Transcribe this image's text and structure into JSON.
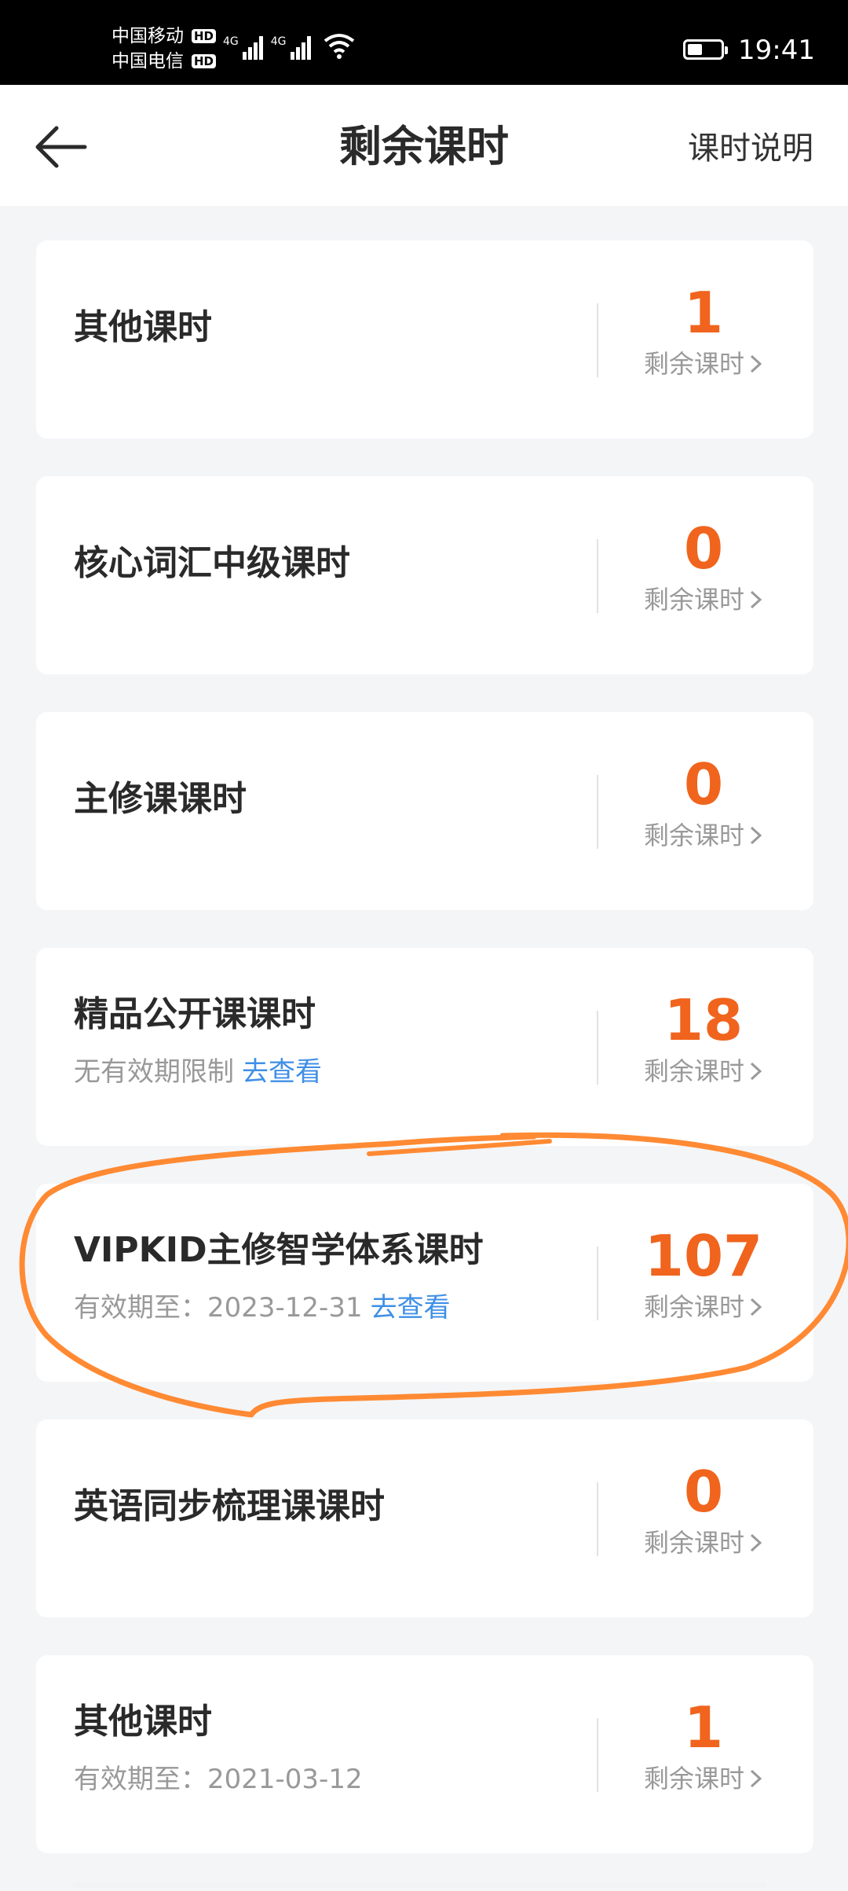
{
  "status_bar": {
    "carrier_1": "中国移动",
    "carrier_2": "中国电信",
    "hd_label": "HD",
    "network_1": "4G",
    "network_2": "4G",
    "time": "19:41",
    "battery_level": 0.45
  },
  "header": {
    "title": "剩余课时",
    "right_link": "课时说明"
  },
  "cards": [
    {
      "name": "其他课时",
      "count": "1",
      "caption": "剩余课时"
    },
    {
      "name": "核心词汇中级课时",
      "count": "0",
      "caption": "剩余课时"
    },
    {
      "name": "主修课课时",
      "count": "0",
      "caption": "剩余课时"
    },
    {
      "name": "精品公开课课时",
      "sub": "无有效期限制",
      "link": "去查看",
      "count": "18",
      "caption": "剩余课时"
    },
    {
      "name": "VIPKID主修智学体系课时",
      "sub": "有效期至：2023-12-31",
      "link": "去查看",
      "count": "107",
      "caption": "剩余课时"
    },
    {
      "name": "英语同步梳理课课时",
      "count": "0",
      "caption": "剩余课时"
    },
    {
      "name": "其他课时",
      "sub": "有效期至：2021-03-12",
      "count": "1",
      "caption": "剩余课时"
    }
  ],
  "colors": {
    "accent": "#f0641e",
    "link": "#3f8fe6",
    "annotation": "#ff8a33"
  }
}
